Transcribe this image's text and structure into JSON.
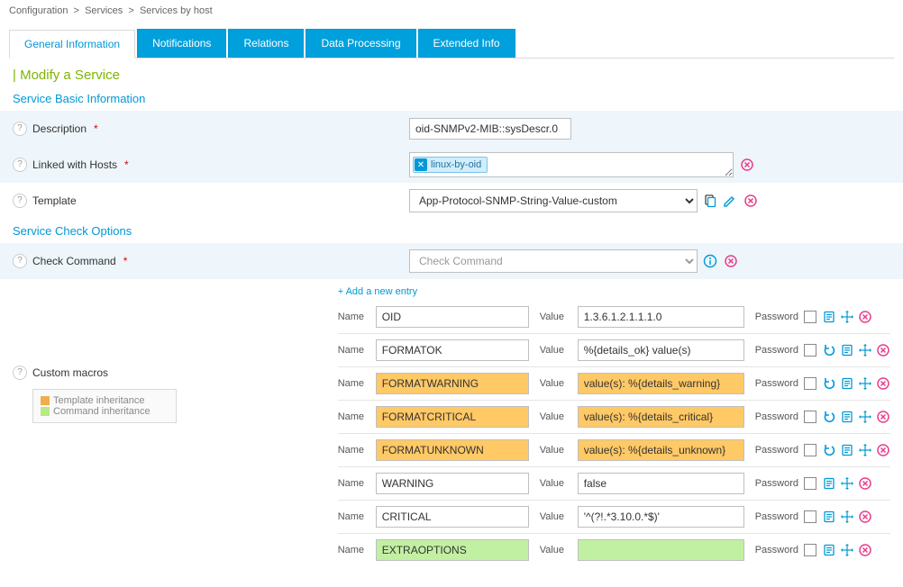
{
  "breadcrumb": [
    "Configuration",
    "Services",
    "Services by host"
  ],
  "tabs": [
    "General Information",
    "Notifications",
    "Relations",
    "Data Processing",
    "Extended Info"
  ],
  "page_title": "Modify a Service",
  "sections": {
    "basic_header": "Service Basic Information",
    "check_header": "Service Check Options"
  },
  "fields": {
    "description_label": "Description",
    "description_value": "oid-SNMPv2-MIB::sysDescr.0",
    "linked_label": "Linked with Hosts",
    "linked_tag": "linux-by-oid",
    "template_label": "Template",
    "template_value": "App-Protocol-SNMP-String-Value-custom",
    "check_command_label": "Check Command",
    "check_command_placeholder": "Check Command",
    "custom_macros_label": "Custom macros",
    "add_entry": "+ Add a new entry"
  },
  "legend": {
    "template": "Template inheritance",
    "command": "Command inheritance"
  },
  "macro_labels": {
    "name": "Name",
    "value": "Value",
    "password": "Password"
  },
  "macros": [
    {
      "name": "OID",
      "value": "1.3.6.1.2.1.1.1.0",
      "inherit": "none",
      "revert": false
    },
    {
      "name": "FORMATOK",
      "value": "%{details_ok} value(s)",
      "inherit": "none",
      "revert": true
    },
    {
      "name": "FORMATWARNING",
      "value": "value(s): %{details_warning}",
      "inherit": "orange",
      "revert": true
    },
    {
      "name": "FORMATCRITICAL",
      "value": "value(s): %{details_critical}",
      "inherit": "orange",
      "revert": true
    },
    {
      "name": "FORMATUNKNOWN",
      "value": "value(s): %{details_unknown}",
      "inherit": "orange",
      "revert": true
    },
    {
      "name": "WARNING",
      "value": "false",
      "inherit": "none",
      "revert": false
    },
    {
      "name": "CRITICAL",
      "value": "'^(?!.*3.10.0.*$)'",
      "inherit": "none",
      "revert": false
    },
    {
      "name": "EXTRAOPTIONS",
      "value": "",
      "inherit": "green",
      "revert": false
    }
  ]
}
